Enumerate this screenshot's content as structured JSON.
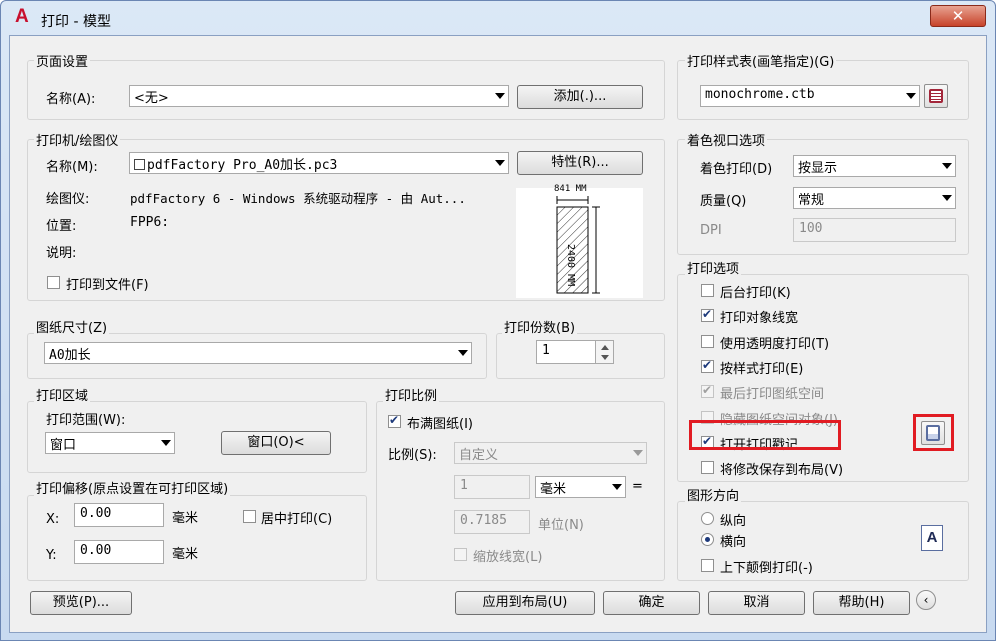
{
  "window": {
    "title": "打印 - 模型",
    "app_icon": "A"
  },
  "page_setup": {
    "group": "页面设置",
    "name_label": "名称(A):",
    "name_value": "<无>",
    "add_button": "添加(.)..."
  },
  "printer": {
    "group": "打印机/绘图仪",
    "name_label": "名称(M):",
    "name_value": "pdfFactory Pro_A0加长.pc3",
    "properties_button": "特性(R)...",
    "plotter_label": "绘图仪:",
    "plotter_value": "pdfFactory 6 - Windows 系统驱动程序 - 由 Aut...",
    "location_label": "位置:",
    "location_value": "FPP6:",
    "description_label": "说明:",
    "print_to_file": "打印到文件(F)",
    "preview_width": "841 MM",
    "preview_height": "2400 MM"
  },
  "paper_size": {
    "group": "图纸尺寸(Z)",
    "value": "A0加长"
  },
  "copies": {
    "group": "打印份数(B)",
    "value": "1"
  },
  "plot_area": {
    "group": "打印区域",
    "range_label": "打印范围(W):",
    "range_value": "窗口",
    "window_button": "窗口(O)<"
  },
  "plot_offset": {
    "group": "打印偏移(原点设置在可打印区域)",
    "x_label": "X:",
    "x_value": "0.00",
    "y_label": "Y:",
    "y_value": "0.00",
    "unit": "毫米",
    "center": "居中打印(C)"
  },
  "plot_scale": {
    "group": "打印比例",
    "fit_paper": "布满图纸(I)",
    "scale_label": "比例(S):",
    "scale_value": "自定义",
    "value1": "1",
    "unit_value": "毫米",
    "equals": "=",
    "value2": "0.7185",
    "unit_label": "单位(N)",
    "scale_lineweights": "缩放线宽(L)"
  },
  "plot_style": {
    "group": "打印样式表(画笔指定)(G)",
    "value": "monochrome.ctb"
  },
  "shaded": {
    "group": "着色视口选项",
    "shade_label": "着色打印(D)",
    "shade_value": "按显示",
    "quality_label": "质量(Q)",
    "quality_value": "常规",
    "dpi_label": "DPI",
    "dpi_value": "100"
  },
  "plot_options": {
    "group": "打印选项",
    "items": [
      {
        "label": "后台打印(K)",
        "checked": false,
        "enabled": true
      },
      {
        "label": "打印对象线宽",
        "checked": true,
        "enabled": true
      },
      {
        "label": "使用透明度打印(T)",
        "checked": false,
        "enabled": true
      },
      {
        "label": "按样式打印(E)",
        "checked": true,
        "enabled": true
      },
      {
        "label": "最后打印图纸空间",
        "checked": true,
        "enabled": false
      },
      {
        "label": "隐藏图纸空间对象(J)",
        "checked": false,
        "enabled": false
      },
      {
        "label": "打开打印戳记",
        "checked": true,
        "enabled": true
      },
      {
        "label": "将修改保存到布局(V)",
        "checked": false,
        "enabled": true
      }
    ]
  },
  "orientation": {
    "group": "图形方向",
    "portrait": "纵向",
    "landscape": "横向",
    "upside_down": "上下颠倒打印(-)",
    "selected": "landscape"
  },
  "footer": {
    "preview": "预览(P)...",
    "apply": "应用到布局(U)",
    "ok": "确定",
    "cancel": "取消",
    "help": "帮助(H)"
  },
  "colors": {
    "highlight": "#e11b22",
    "check": "#1e3a7b"
  }
}
